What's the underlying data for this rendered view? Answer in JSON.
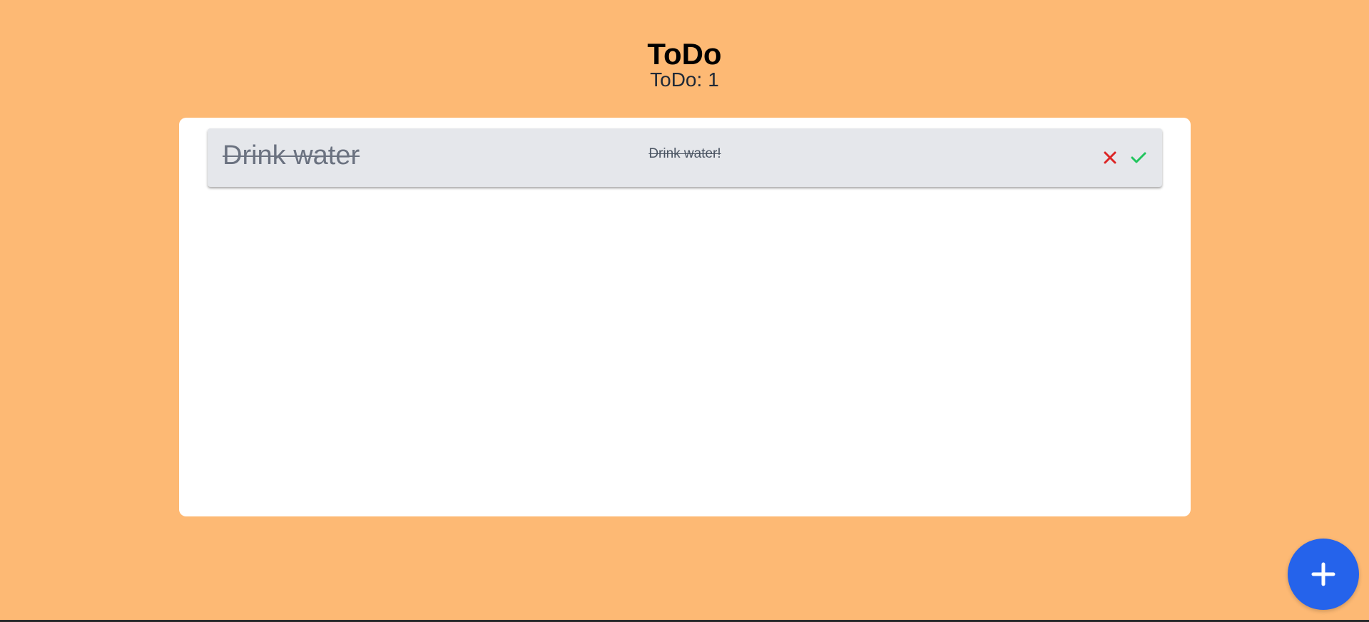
{
  "app": {
    "title": "ToDo",
    "count_label": "ToDo:",
    "count_value": "1"
  },
  "todos": [
    {
      "title": "Drink water",
      "description": "Drink water!",
      "completed": true,
      "delete_icon": "close-icon",
      "complete_icon": "check-icon"
    }
  ],
  "fab": {
    "icon": "plus-icon"
  },
  "colors": {
    "background": "#fdb974",
    "panel": "#ffffff",
    "item": "#e5e7eb",
    "delete": "#dc2626",
    "complete": "#22c55e",
    "fab": "#2563eb"
  }
}
